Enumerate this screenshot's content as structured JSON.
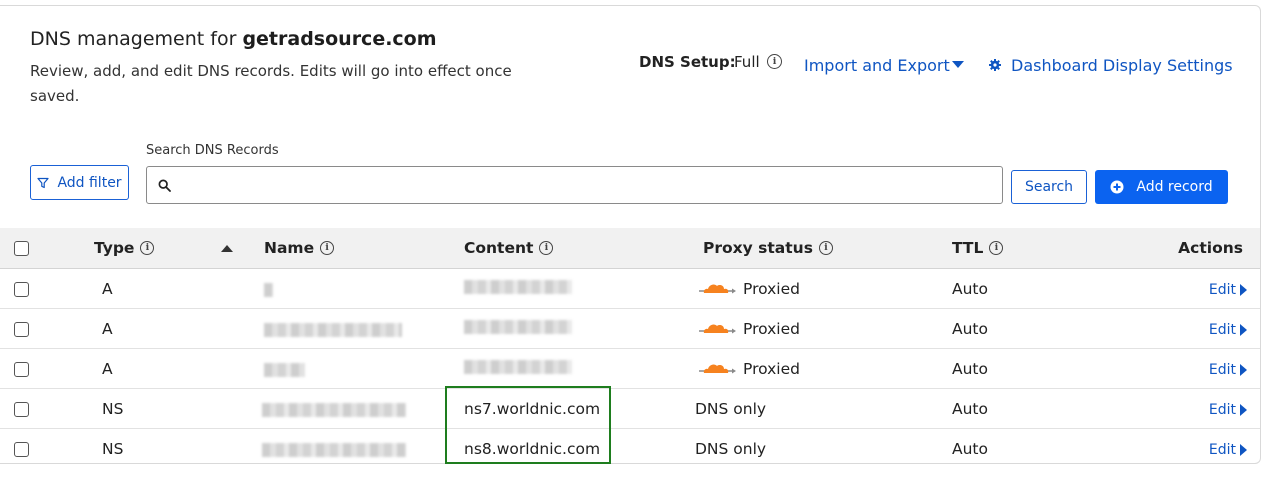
{
  "header": {
    "title_prefix": "DNS management for ",
    "domain": "getradsource.com",
    "subtitle": "Review, add, and edit DNS records. Edits will go into effect once saved.",
    "dns_setup_label": "DNS Setup:",
    "dns_setup_value": "Full",
    "import_export_label": "Import and Export",
    "dashboard_settings_label": "Dashboard Display Settings"
  },
  "toolbar": {
    "add_filter_label": "Add filter",
    "search_label": "Search DNS Records",
    "search_value": "",
    "search_button_label": "Search",
    "add_record_label": "Add record"
  },
  "table": {
    "columns": {
      "type": "Type",
      "name": "Name",
      "content": "Content",
      "proxy": "Proxy status",
      "ttl": "TTL",
      "actions": "Actions"
    },
    "rows": [
      {
        "type": "A",
        "content": "",
        "proxy": "Proxied",
        "ttl": "Auto",
        "action": "Edit"
      },
      {
        "type": "A",
        "content": "",
        "proxy": "Proxied",
        "ttl": "Auto",
        "action": "Edit"
      },
      {
        "type": "A",
        "content": "",
        "proxy": "Proxied",
        "ttl": "Auto",
        "action": "Edit"
      },
      {
        "type": "NS",
        "content": "ns7.worldnic.com",
        "proxy": "DNS only",
        "ttl": "Auto",
        "action": "Edit"
      },
      {
        "type": "NS",
        "content": "ns8.worldnic.com",
        "proxy": "DNS only",
        "ttl": "Auto",
        "action": "Edit"
      }
    ]
  },
  "colors": {
    "link": "#0f55c2",
    "primary_button": "#0b63f0",
    "cloud_orange": "#f6821f",
    "highlight_box": "#1e7d1e"
  },
  "icons": {
    "info": "info-circle-icon",
    "caret": "caret-down-icon",
    "gear": "gear-icon",
    "filter": "filter-icon",
    "search": "search-icon",
    "add": "plus-circle-icon",
    "proxied": "orange-cloud-icon",
    "edit": "caret-right-icon"
  }
}
